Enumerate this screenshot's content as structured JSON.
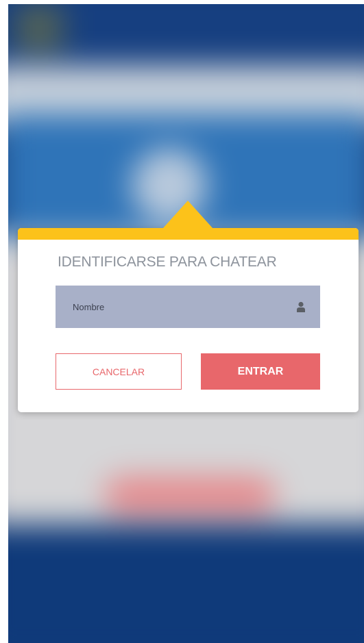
{
  "dialog": {
    "title": "IDENTIFICARSE PARA CHATEAR",
    "name_placeholder": "Nombre",
    "name_icon": "user-icon",
    "cancel_label": "CANCELAR",
    "enter_label": "ENTRAR"
  },
  "colors": {
    "accent_yellow": "#fcc21a",
    "button_red": "#e8676b",
    "input_bg": "#a8b0c8",
    "title_grey": "#8d939c"
  }
}
